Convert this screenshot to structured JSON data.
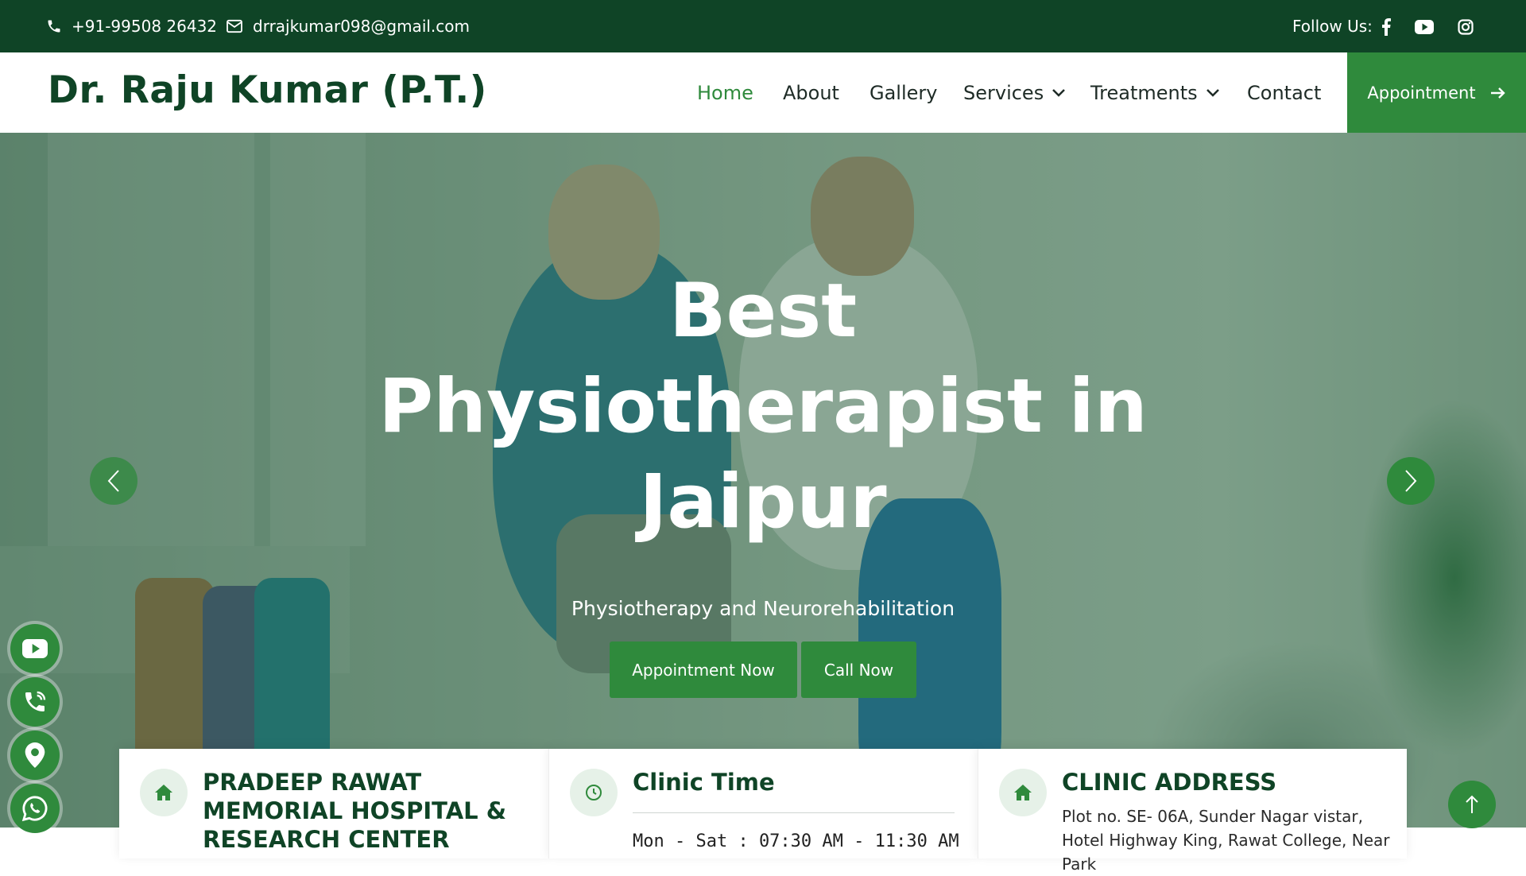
{
  "topbar": {
    "phone": "+91-99508 26432",
    "email": "drrajkumar098@gmail.com",
    "follow_label": "Follow Us:",
    "social": [
      "facebook-icon",
      "youtube-icon",
      "instagram-icon"
    ]
  },
  "navbar": {
    "brand": "Dr. Raju Kumar (P.T.)",
    "links": [
      "Home",
      "About",
      "Gallery",
      "Services",
      "Treatments",
      "Contact"
    ],
    "active": "Home",
    "appointment_label": "Appointment"
  },
  "hero": {
    "title_line1": "Best",
    "title_line2": "Physiotherapist in",
    "title_line3": "Jaipur",
    "subtitle": "Physiotherapy and Neurorehabilitation",
    "primary_button": "Appointment Now",
    "secondary_button": "Call Now"
  },
  "side_buttons": [
    "youtube-icon",
    "phone-icon",
    "location-icon",
    "whatsapp-icon"
  ],
  "cards": {
    "hospital": {
      "title": "PRADEEP RAWAT MEMORIAL HOSPITAL & RESEARCH CENTER"
    },
    "clinic_time": {
      "title": "Clinic Time",
      "hours": "Mon - Sat : 07:30 AM - 11:30 AM"
    },
    "address": {
      "title": "CLINIC ADDRESS",
      "text": "Plot no. SE- 06A, Sunder Nagar vistar, Hotel Highway King, Rawat College, Near Park"
    }
  },
  "colors": {
    "dark_green": "#0f4426",
    "accent_green": "#2f8a3c"
  }
}
